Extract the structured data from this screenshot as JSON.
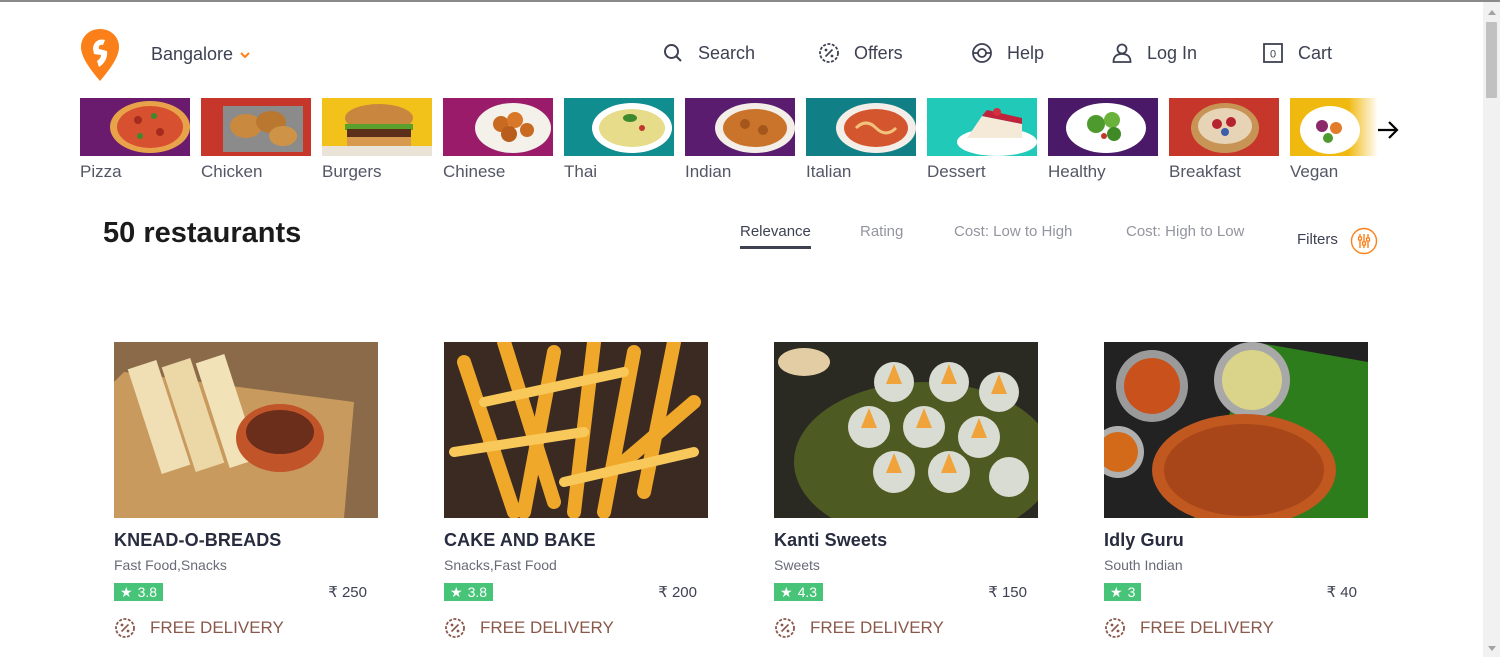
{
  "header": {
    "location": "Bangalore",
    "nav": [
      {
        "label": "Search",
        "icon": "search-icon"
      },
      {
        "label": "Offers",
        "icon": "offers-icon"
      },
      {
        "label": "Help",
        "icon": "help-icon"
      },
      {
        "label": "Log In",
        "icon": "user-icon"
      },
      {
        "label": "Cart",
        "icon": "cart-icon",
        "count": "0"
      }
    ]
  },
  "categories": [
    {
      "label": "Pizza",
      "bg": "#6a1b6e"
    },
    {
      "label": "Chicken",
      "bg": "#c7362a"
    },
    {
      "label": "Burgers",
      "bg": "#f2c21a"
    },
    {
      "label": "Chinese",
      "bg": "#9a1b6a"
    },
    {
      "label": "Thai",
      "bg": "#0f8d8f"
    },
    {
      "label": "Indian",
      "bg": "#5a1c6e"
    },
    {
      "label": "Italian",
      "bg": "#117f86"
    },
    {
      "label": "Dessert",
      "bg": "#21c9b8"
    },
    {
      "label": "Healthy",
      "bg": "#4a1a68"
    },
    {
      "label": "Breakfast",
      "bg": "#c7362a"
    },
    {
      "label": "Vegan",
      "bg": "#f0b90f"
    }
  ],
  "listing": {
    "count_text": "50 restaurants",
    "sort_options": [
      "Relevance",
      "Rating",
      "Cost: Low to High",
      "Cost: High to Low"
    ],
    "active_sort": "Relevance",
    "filters_label": "Filters"
  },
  "restaurants": [
    {
      "name": "KNEAD-O-BREADS",
      "cuisine": "Fast Food,Snacks",
      "rating": "3.8",
      "price": "₹ 250",
      "offer": "FREE DELIVERY"
    },
    {
      "name": "CAKE AND BAKE",
      "cuisine": "Snacks,Fast Food",
      "rating": "3.8",
      "price": "₹ 200",
      "offer": "FREE DELIVERY"
    },
    {
      "name": "Kanti Sweets",
      "cuisine": "Sweets",
      "rating": "4.3",
      "price": "₹ 150",
      "offer": "FREE DELIVERY"
    },
    {
      "name": "Idly Guru",
      "cuisine": "South Indian",
      "rating": "3",
      "price": "₹ 40",
      "offer": "FREE DELIVERY"
    }
  ],
  "colors": {
    "brand": "#fc8019",
    "rating_bg": "#48c479",
    "offer_text": "#8a584b"
  }
}
